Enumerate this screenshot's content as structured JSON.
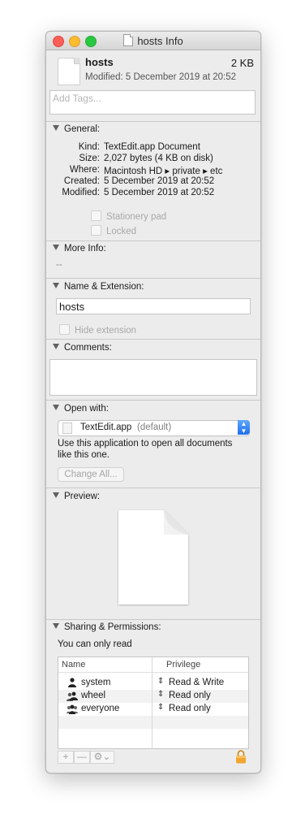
{
  "window": {
    "title": "hosts Info"
  },
  "header": {
    "name": "hosts",
    "size": "2 KB",
    "modified": "Modified: 5 December 2019 at 20:52"
  },
  "tags": {
    "placeholder": "Add Tags..."
  },
  "general": {
    "heading": "General:",
    "rows": [
      {
        "label": "Kind:",
        "value": "TextEdit.app Document"
      },
      {
        "label": "Size:",
        "value": "2,027 bytes (4 KB on disk)"
      },
      {
        "label": "Where:",
        "value": "Macintosh HD ▸ private ▸ etc"
      },
      {
        "label": "Created:",
        "value": "5 December 2019 at 20:52"
      },
      {
        "label": "Modified:",
        "value": "5 December 2019 at 20:52"
      }
    ],
    "stationery": "Stationery pad",
    "locked": "Locked"
  },
  "more_info": {
    "heading": "More Info:",
    "value": "--"
  },
  "name_ext": {
    "heading": "Name & Extension:",
    "value": "hosts",
    "hide_extension": "Hide extension"
  },
  "comments": {
    "heading": "Comments:"
  },
  "open_with": {
    "heading": "Open with:",
    "app": "TextEdit.app",
    "app_suffix": "(default)",
    "description_line1": "Use this application to open all documents",
    "description_line2": "like this one.",
    "change_all": "Change All..."
  },
  "preview": {
    "heading": "Preview:"
  },
  "sharing": {
    "heading": "Sharing & Permissions:",
    "note": "You can only read",
    "col_name": "Name",
    "col_privilege": "Privilege",
    "rows": [
      {
        "name": "system",
        "privilege": "Read & Write"
      },
      {
        "name": "wheel",
        "privilege": "Read only"
      },
      {
        "name": "everyone",
        "privilege": "Read only"
      }
    ],
    "add": "+",
    "remove": "—",
    "gear": "⚙⌄"
  },
  "icons": {
    "lock": "lock-icon",
    "gear": "gear-icon",
    "doc": "document-icon"
  }
}
